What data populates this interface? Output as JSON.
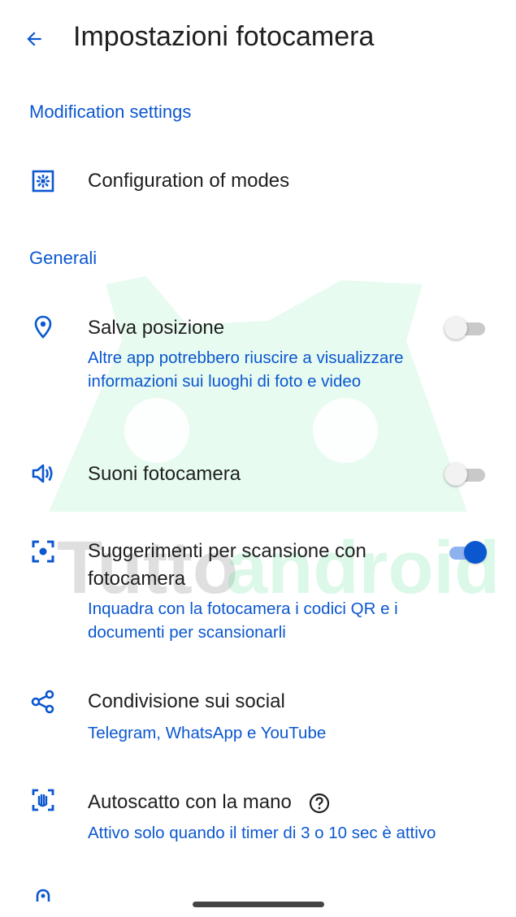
{
  "header": {
    "back_icon": "arrow-back-icon",
    "title": "Impostazioni fotocamera"
  },
  "sections": {
    "modification": "Modification settings",
    "general": "Generali"
  },
  "rows": {
    "modes": {
      "icon": "modes-grid-icon",
      "title": "Configuration of modes"
    },
    "location": {
      "icon": "location-pin-icon",
      "title": "Salva posizione",
      "subtitle": "Altre app potrebbero riuscire a visualizzare informazioni sui luoghi di foto e video",
      "enabled": false
    },
    "sounds": {
      "icon": "volume-icon",
      "title": "Suoni fotocamera",
      "enabled": false
    },
    "scan": {
      "icon": "scan-focus-icon",
      "title": "Suggerimenti per scansione con fotocamera",
      "subtitle": "Inquadra con la fotocamera i codici QR e i documenti per scansionarli",
      "enabled": true
    },
    "social": {
      "icon": "share-icon",
      "title": "Condivisione sui social",
      "subtitle": "Telegram, WhatsApp e YouTube"
    },
    "palm": {
      "icon": "palm-timer-icon",
      "title": "Autoscatto con la mano",
      "help_icon": "help-circle-icon",
      "subtitle": "Attivo solo quando il timer di 3 o 10 sec è attivo"
    }
  },
  "watermark": {
    "text_part1": "Tutto",
    "text_part2": "android"
  },
  "colors": {
    "accent": "#0b57d0",
    "toggle_off_track": "#c9c9c9",
    "toggle_off_thumb": "#f2f2f2",
    "toggle_on_track": "#8eb1f0",
    "watermark_green": "#3ddc84"
  }
}
